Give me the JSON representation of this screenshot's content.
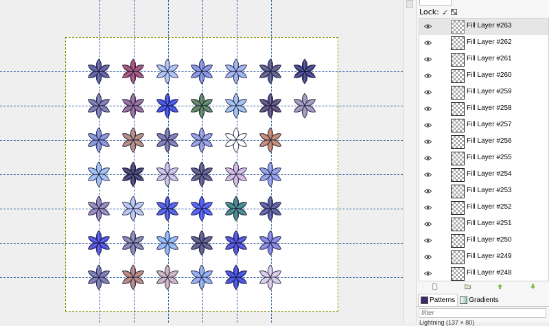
{
  "canvas": {
    "flower_colors": [
      [
        "#3a3a8a",
        "#8a2a5a",
        "#9ab4f0",
        "#6a7ad8",
        "#8aa0e8",
        "#3a3a70",
        "#1a1a6a"
      ],
      [
        "#5a5aa0",
        "#7a4a80",
        "#1a2ad8",
        "#3a6a40",
        "#8ab0e8",
        "#3a2a60",
        "#8a80a8"
      ],
      [
        "#6a7ad0",
        "#a07060",
        "#5a5aa0",
        "#7a8ad8",
        "#ffffff",
        "#b07050"
      ],
      [
        "#8ab0f0",
        "#1a1a50",
        "#c0b4e0",
        "#3a3a70",
        "#c8a8d8",
        "#7a8ae0"
      ],
      [
        "#7a6aa8",
        "#a8b8f0",
        "#2a3ad8",
        "#2a3ae8",
        "#1a6a6a",
        "#3a3a8a"
      ],
      [
        "#2a2ad0",
        "#6a6aa0",
        "#7aa8f0",
        "#3a3a70",
        "#2a2ad0",
        "#6a6ad8"
      ],
      [
        "#5a5aa0",
        "#a06a60",
        "#c0a0b0",
        "#7a9ae8",
        "#1a2ad0",
        "#d0c0e0"
      ]
    ]
  },
  "lock": {
    "label": "Lock:",
    "icons": [
      "brush-lock-icon",
      "alpha-lock-icon"
    ]
  },
  "layers": [
    {
      "name": "Fill Layer #263",
      "selected": true
    },
    {
      "name": "Fill Layer #262"
    },
    {
      "name": "Fill Layer #261"
    },
    {
      "name": "Fill Layer #260"
    },
    {
      "name": "Fill Layer #259"
    },
    {
      "name": "Fill Layer #258"
    },
    {
      "name": "Fill Layer #257"
    },
    {
      "name": "Fill Layer #256"
    },
    {
      "name": "Fill Layer #255"
    },
    {
      "name": "Fill Layer #254"
    },
    {
      "name": "Fill Layer #253"
    },
    {
      "name": "Fill Layer #252"
    },
    {
      "name": "Fill Layer #251"
    },
    {
      "name": "Fill Layer #250"
    },
    {
      "name": "Fill Layer #249"
    },
    {
      "name": "Fill Layer #248"
    }
  ],
  "layer_actions": [
    "new-layer-icon",
    "new-group-icon",
    "raise-layer-icon",
    "lower-layer-icon"
  ],
  "tabs": {
    "patterns": "Patterns",
    "gradients": "Gradients"
  },
  "filter": {
    "placeholder": "filter"
  },
  "status": {
    "text": "Lightning (137 × 80)"
  },
  "colors": {
    "guide": "#2a5aa0",
    "page_border": "#8a8a00",
    "panel_bg": "#f6f6f6"
  }
}
